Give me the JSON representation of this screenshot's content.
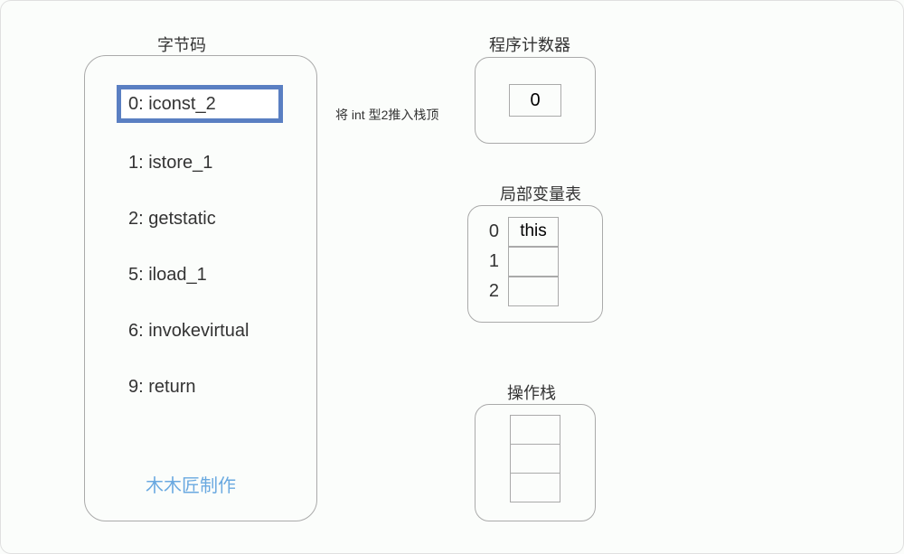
{
  "bytecode": {
    "title": "字节码",
    "instructions": [
      "0: iconst_2",
      "1: istore_1",
      "2: getstatic",
      "5: iload_1",
      "6: invokevirtual",
      "9: return"
    ],
    "highlighted_index": 0
  },
  "annotation": "将 int 型2推入栈顶",
  "program_counter": {
    "title": "程序计数器",
    "value": "0"
  },
  "local_vars": {
    "title": "局部变量表",
    "rows": [
      {
        "index": "0",
        "value": "this"
      },
      {
        "index": "1",
        "value": ""
      },
      {
        "index": "2",
        "value": ""
      }
    ]
  },
  "operand_stack": {
    "title": "操作栈",
    "cells": [
      "",
      "",
      ""
    ]
  },
  "watermark": "木木匠制作"
}
